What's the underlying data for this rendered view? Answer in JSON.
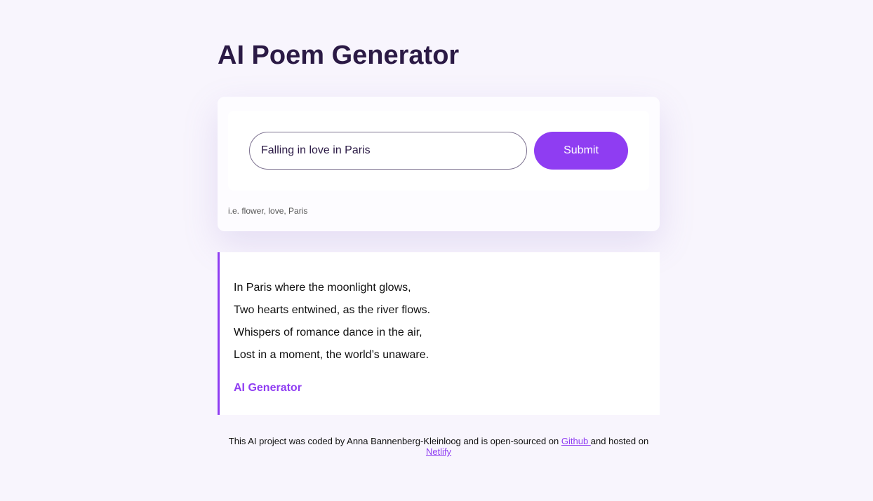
{
  "header": {
    "title": "AI Poem Generator"
  },
  "form": {
    "input_value": "Falling in love in Paris",
    "submit_label": "Submit",
    "hint": "i.e. flower, love, Paris"
  },
  "poem": {
    "lines": [
      "In Paris where the moonlight glows,",
      "Two hearts entwined, as the river flows.",
      "Whispers of romance dance in the air,",
      "Lost in a moment, the world’s unaware."
    ],
    "signature": "AI Generator"
  },
  "footer": {
    "text_before": "This AI project was coded by Anna Bannenberg-Kleinloog and is open-sourced on ",
    "github_label": "Github ",
    "text_middle": "and hosted on ",
    "netlify_label": "Netlify"
  },
  "colors": {
    "accent": "#8f3df2",
    "title": "#2b1a45",
    "background": "#f8f5fd"
  }
}
